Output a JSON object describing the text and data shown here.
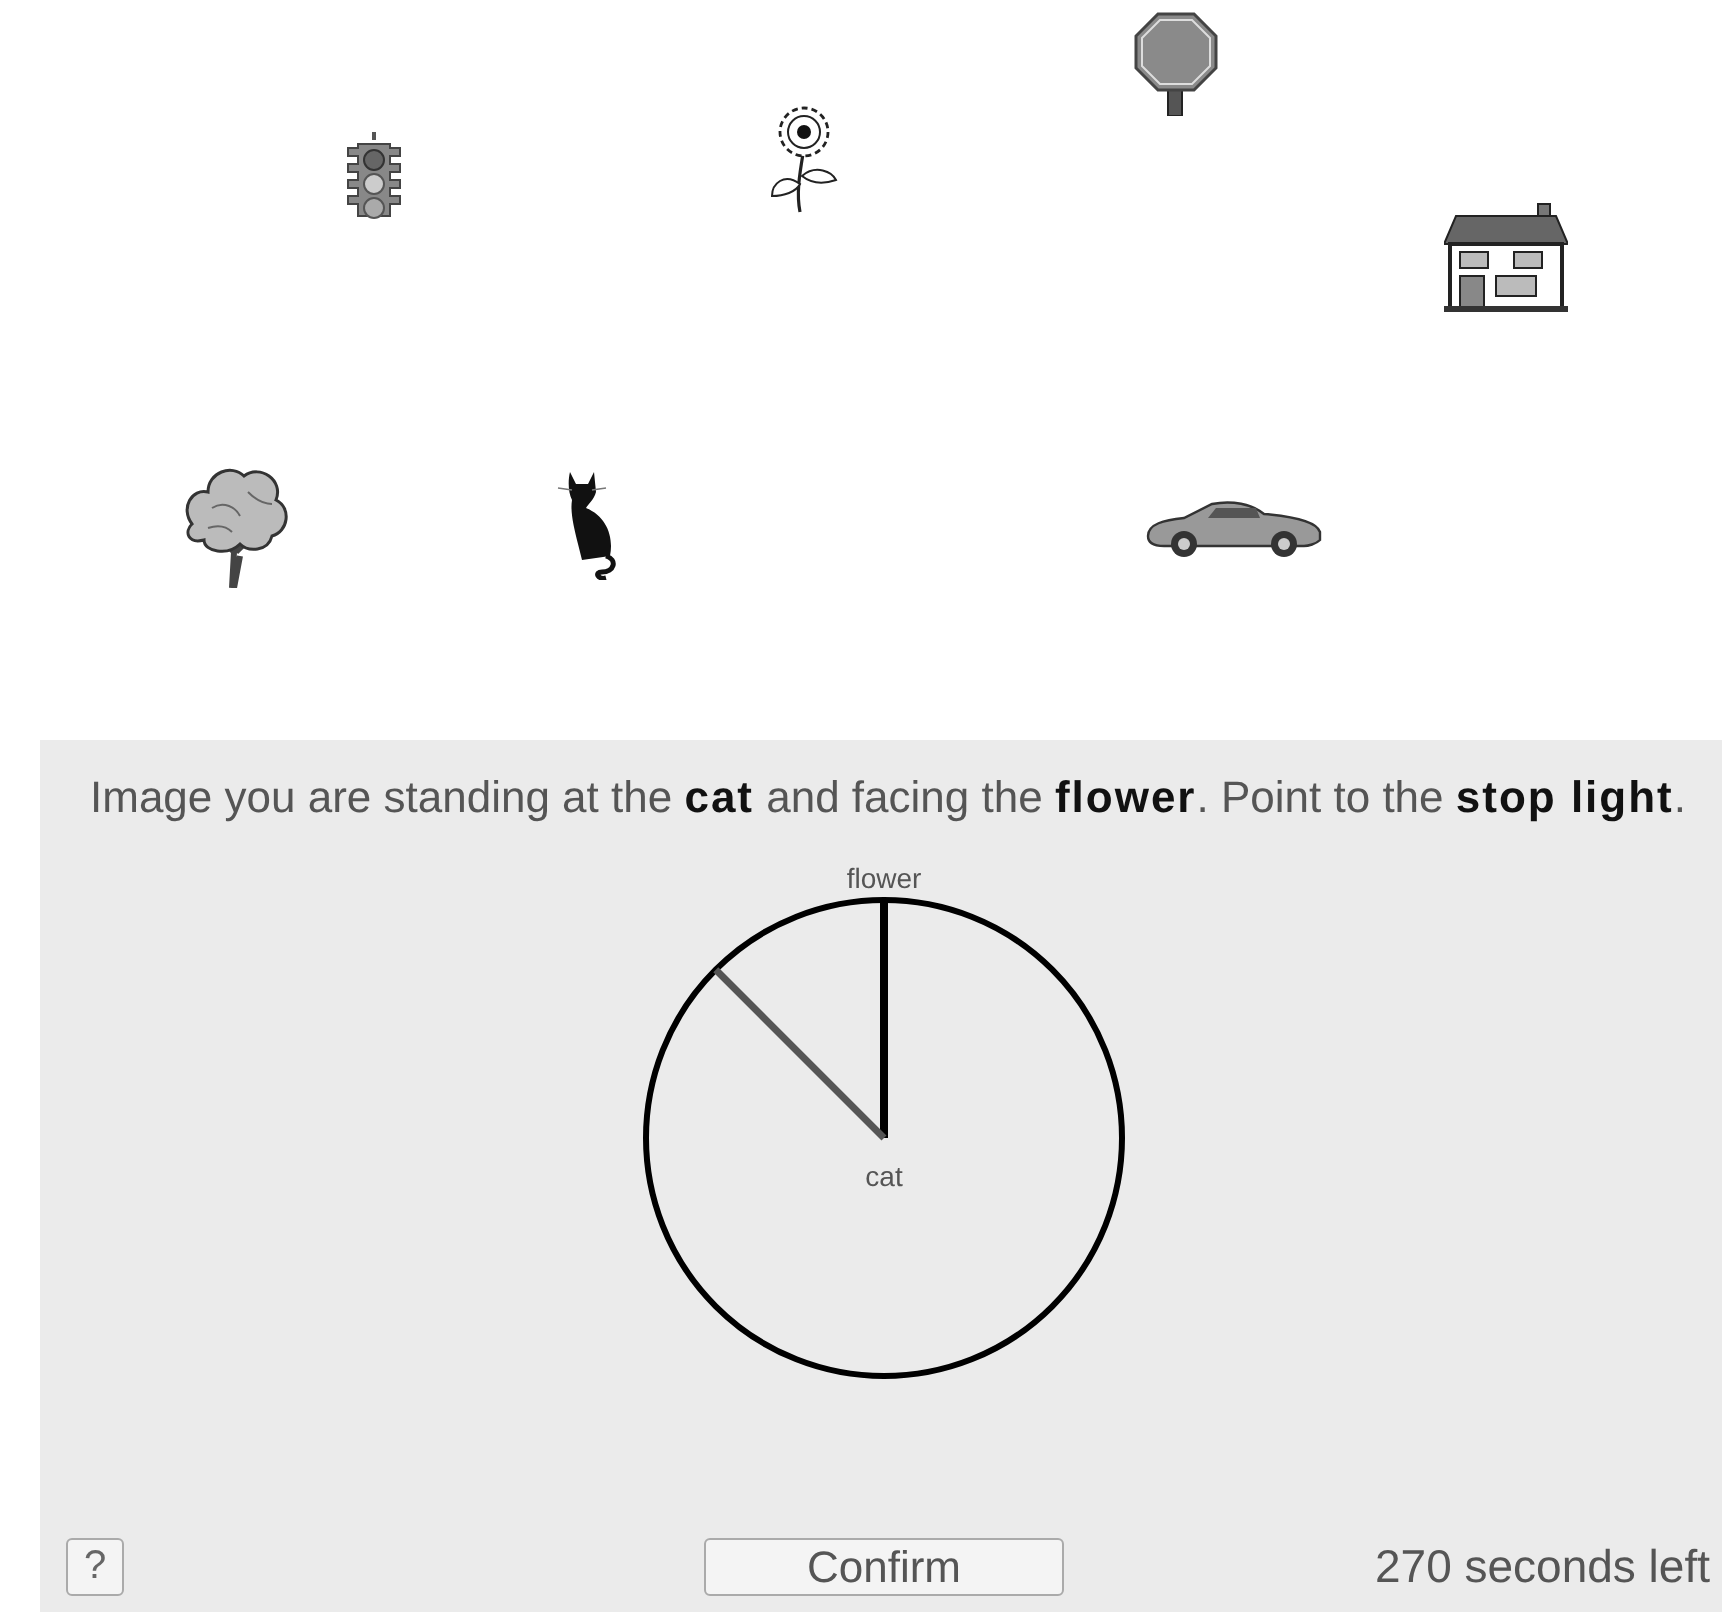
{
  "landmarks": [
    {
      "kind": "traffic-light"
    },
    {
      "kind": "flower"
    },
    {
      "kind": "stop-sign"
    },
    {
      "kind": "house"
    },
    {
      "kind": "tree"
    },
    {
      "kind": "cat"
    },
    {
      "kind": "car"
    }
  ],
  "prompt": "Image you are standing at the **cat** and facing the **flower**. Point to the **stop light**.",
  "dial": {
    "facing_label": "flower",
    "center_label": "cat"
  },
  "help_button": "?",
  "confirm_button": "Confirm",
  "timer": "270 seconds left"
}
